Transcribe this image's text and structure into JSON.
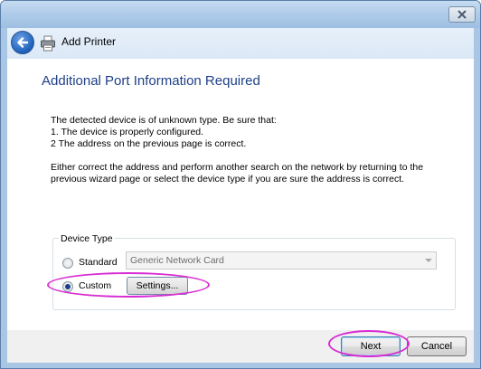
{
  "dialog": {
    "header_title": "Add Printer",
    "page_title": "Additional Port Information Required"
  },
  "message": {
    "line1": "The detected device is of unknown type.  Be sure that:",
    "line2": "1. The device is properly configured.",
    "line3": "2  The address on the previous page is correct.",
    "line4": "Either correct the address and perform another search on the network by returning to the",
    "line5": "previous wizard page or select the device type if you are sure the address is correct."
  },
  "device_type": {
    "legend": "Device Type",
    "standard_label": "Standard",
    "standard_selected": false,
    "standard_value": "Generic Network Card",
    "custom_label": "Custom",
    "custom_selected": true,
    "settings_label": "Settings..."
  },
  "footer": {
    "next_label": "Next",
    "cancel_label": "Cancel"
  },
  "colors": {
    "highlight": "#d82bd3",
    "title_blue": "#1e3f88"
  }
}
